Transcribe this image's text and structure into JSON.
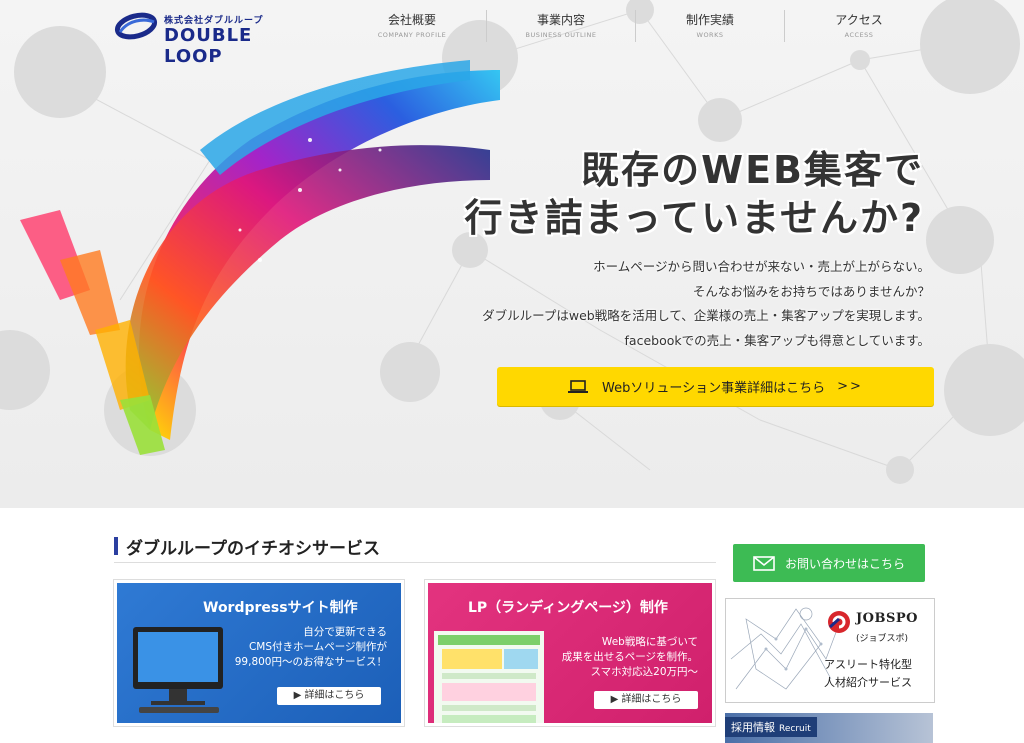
{
  "brand": {
    "company_jp": "株式会社ダブルループ",
    "name": "DOUBLE LOOP",
    "color": "#1a2a8a"
  },
  "nav": {
    "items": [
      {
        "jp": "会社概要",
        "en": "COMPANY PROFILE"
      },
      {
        "jp": "事業内容",
        "en": "BUSINESS OUTLINE"
      },
      {
        "jp": "制作実績",
        "en": "WORKS"
      },
      {
        "jp": "アクセス",
        "en": "ACCESS"
      }
    ]
  },
  "hero": {
    "headline_1": "既存のWEB集客で",
    "headline_2": "行き詰まっていませんか?",
    "lead": [
      "ホームページから問い合わせが来ない・売上が上がらない。",
      "そんなお悩みをお持ちではありませんか？",
      "ダブルループはweb戦略を活用して、企業様の売上・集客アップを実現します。",
      "facebookでの売上・集客アップも得意としています。"
    ],
    "cta_label": "Webソリューション事業詳細はこちら",
    "cta_arrows": ">>",
    "cta_icon": "laptop-icon",
    "cta_color": "#ffd800"
  },
  "services": {
    "title": "ダブルループのイチオシサービス",
    "cards": [
      {
        "title": "Wordpressサイト制作",
        "lines": [
          "自分で更新できる",
          "CMS付きホームページ制作が",
          "99,800円〜のお得なサービス！"
        ],
        "button": "詳細はこちら",
        "color": "#2f7ad4"
      },
      {
        "title": "LP（ランディングページ）制作",
        "lines": [
          "Web戦略に基づいて",
          "成果を出せるページを制作。",
          "スマホ対応込20万円〜"
        ],
        "button": "詳細はこちら",
        "color": "#e3337f"
      }
    ]
  },
  "sidebar": {
    "contact_label": "お問い合わせはこちら",
    "contact_color": "#3dbb54",
    "jobspo": {
      "name": "JOBSPO",
      "kana": "(ジョブスポ)",
      "tagline_1": "アスリート特化型",
      "tagline_2": "人材紹介サービス"
    },
    "recruit": {
      "label": "採用情報",
      "label_en": "Recruit"
    }
  }
}
